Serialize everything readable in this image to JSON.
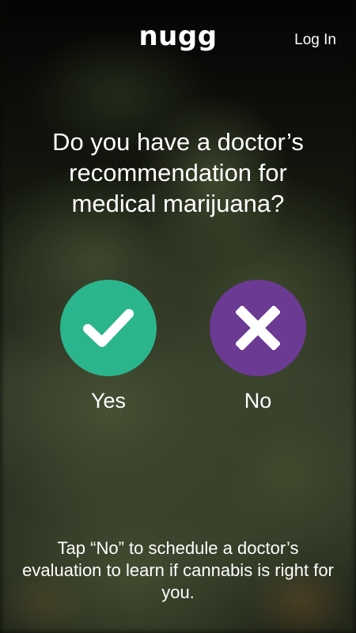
{
  "header": {
    "logo": "nugg",
    "login_label": "Log In"
  },
  "question": {
    "text": "Do you have a doctor’s recommendation for medical marijuana?"
  },
  "choices": {
    "yes": {
      "label": "Yes",
      "icon": "check-icon",
      "color": "#2bb58d"
    },
    "no": {
      "label": "No",
      "icon": "x-icon",
      "color": "#6b3a93"
    }
  },
  "footer": {
    "text": "Tap “No” to schedule a doctor’s evaluation  to learn if cannabis is right for you."
  }
}
